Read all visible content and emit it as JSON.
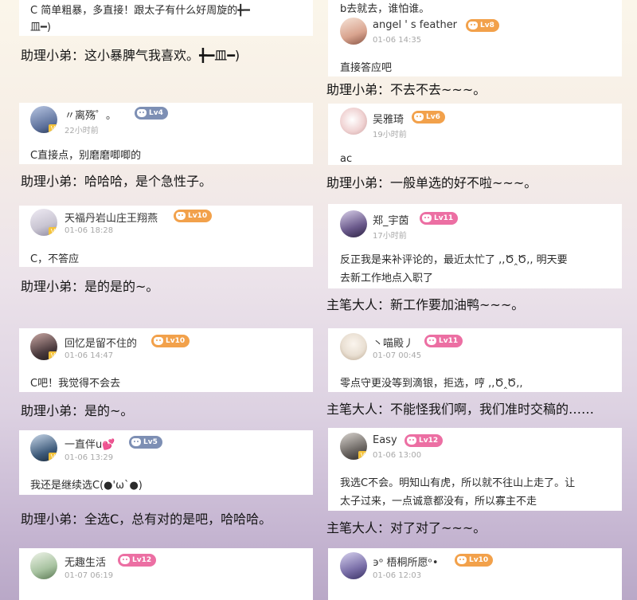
{
  "left": {
    "top_card": {
      "text_line1": "C 简单粗暴，多直接！跟太子有什么好周旋的╋━",
      "text_line2": "皿━)"
    },
    "top_reply": "助理小弟：这小暴脾气我喜欢。╋━皿━)",
    "comments": [
      {
        "user": "〃离殇゜。",
        "level": "Lv4",
        "time": "22小时前",
        "text": "C直接点，别磨磨唧唧的",
        "reply": "助理小弟：哈哈哈，是个急性子。",
        "avatar_color": "#5b6f9a",
        "level_color": "#7d8fb4"
      },
      {
        "user": "天福丹岩山庄王翔燕",
        "level": "Lv10",
        "time": "01-06 18:28",
        "text": "C，不答应",
        "reply": "助理小弟：是的是的~。",
        "avatar_color": "#c9c5d2",
        "level_color": "#f2a14b"
      },
      {
        "user": "回忆是留不住的",
        "level": "Lv10",
        "time": "01-06 14:47",
        "text": "C吧！我觉得不会去",
        "reply": "助理小弟：是的~。",
        "avatar_color": "#4a3a3d",
        "level_color": "#f2a14b"
      },
      {
        "user": "一直伴u💕",
        "level": "Lv5",
        "time": "01-06 13:29",
        "text": "我还是继续选C(●'ω`●)",
        "reply": "助理小弟：全选C，总有对的是吧，哈哈哈。",
        "avatar_color": "#3d5a7a",
        "level_color": "#7d8fb4"
      },
      {
        "user": "无趣生活",
        "level": "Lv12",
        "time": "01-07 06:19",
        "avatar_color": "#a7c2a0",
        "level_color": "#ec6fa3"
      }
    ]
  },
  "right": {
    "top_card": {
      "text_line1": "b去就去，谁怕谁。",
      "user": "angel ' s feather",
      "level": "Lv8",
      "time": "01-06 14:35",
      "text": "直接答应吧",
      "avatar_color": "#d9a48f",
      "level_color": "#f2a14b"
    },
    "top_reply": "助理小弟：不去不去~~~。",
    "comments": [
      {
        "user": "吴雅琦",
        "level": "Lv6",
        "time": "19小时前",
        "text": "ac",
        "reply": "助理小弟：一般单选的好不啦~~~。",
        "avatar_color": "#f0d3d3",
        "level_color": "#f2a14b"
      },
      {
        "user": "郑_宇茵",
        "level": "Lv11",
        "time": "17小时前",
        "text_line1": "反正我是来补评论的，最近太忙了 ,,Ծ‸Ծ,, 明天要",
        "text_line2": "去新工作地点入职了",
        "reply": "主笔大人：新工作要加油鸭~~~。",
        "avatar_color": "#6b5a8c",
        "level_color": "#ec6fa3"
      },
      {
        "user": "丶喵殿丿",
        "level": "Lv11",
        "time": "01-07 00:45",
        "text": "零点守更没等到滴银，拒选，哼 ,,Ծ‸Ծ,,",
        "reply": "主笔大人：不能怪我们啊，我们准时交稿的……",
        "avatar_color": "#e9dfd2",
        "level_color": "#ec6fa3"
      },
      {
        "user": "Easy",
        "level": "Lv12",
        "time": "01-06 13:00",
        "text_line1": "我选C不会。明知山有虎，所以就不往山上走了。让",
        "text_line2": "太子过来，一点诚意都没有，所以寡主不走",
        "reply": "主笔大人：对了对了~~~。",
        "avatar_color": "#6f6a66",
        "level_color": "#ec6fa3"
      },
      {
        "user": "϶ᵒ 梧桐所愿ᵒ•",
        "level": "Lv10",
        "time": "01-06 12:03",
        "avatar_color": "#7a6fa8",
        "level_color": "#f2a14b"
      }
    ]
  }
}
